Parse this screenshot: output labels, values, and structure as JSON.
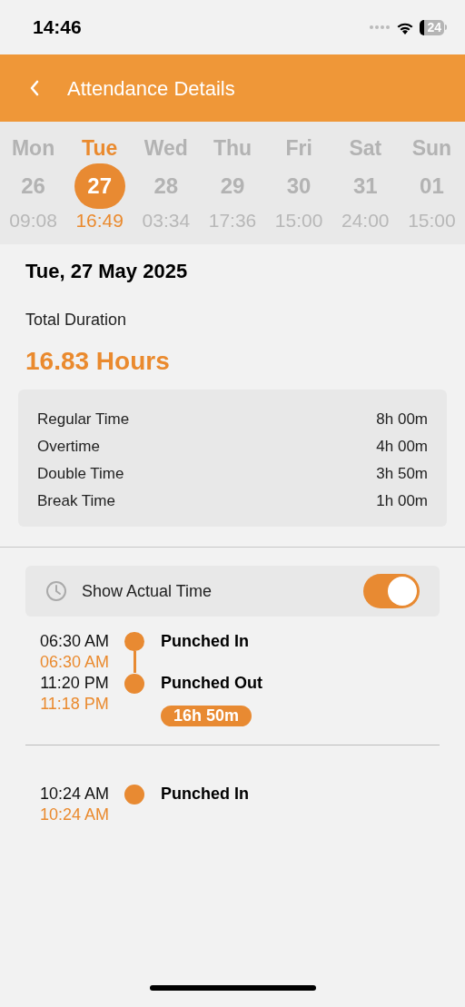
{
  "status_bar": {
    "time": "14:46",
    "battery": "24"
  },
  "header": {
    "title": "Attendance Details"
  },
  "days": [
    {
      "name": "Mon",
      "date": "26",
      "hours": "09:08",
      "selected": false
    },
    {
      "name": "Tue",
      "date": "27",
      "hours": "16:49",
      "selected": true
    },
    {
      "name": "Wed",
      "date": "28",
      "hours": "03:34",
      "selected": false
    },
    {
      "name": "Thu",
      "date": "29",
      "hours": "17:36",
      "selected": false
    },
    {
      "name": "Fri",
      "date": "30",
      "hours": "15:00",
      "selected": false
    },
    {
      "name": "Sat",
      "date": "31",
      "hours": "24:00",
      "selected": false
    },
    {
      "name": "Sun",
      "date": "01",
      "hours": "15:00",
      "selected": false
    }
  ],
  "date_title": "Tue, 27 May 2025",
  "total": {
    "label": "Total Duration",
    "value": "16.83 Hours"
  },
  "breakdown": [
    {
      "label": "Regular Time",
      "value": "8h 00m"
    },
    {
      "label": "Overtime",
      "value": "4h 00m"
    },
    {
      "label": "Double Time",
      "value": "3h 50m"
    },
    {
      "label": "Break Time",
      "value": "1h 00m"
    }
  ],
  "actual_time_toggle": {
    "label": "Show Actual Time",
    "on": true
  },
  "sessions": [
    {
      "punches": [
        {
          "time": "06:30 AM",
          "actual_time": "06:30 AM",
          "label": "Punched In"
        },
        {
          "time": "11:20 PM",
          "actual_time": "11:18 PM",
          "label": "Punched Out"
        }
      ],
      "duration": "16h 50m"
    },
    {
      "punches": [
        {
          "time": "10:24 AM",
          "actual_time": "10:24 AM",
          "label": "Punched In"
        }
      ]
    }
  ]
}
